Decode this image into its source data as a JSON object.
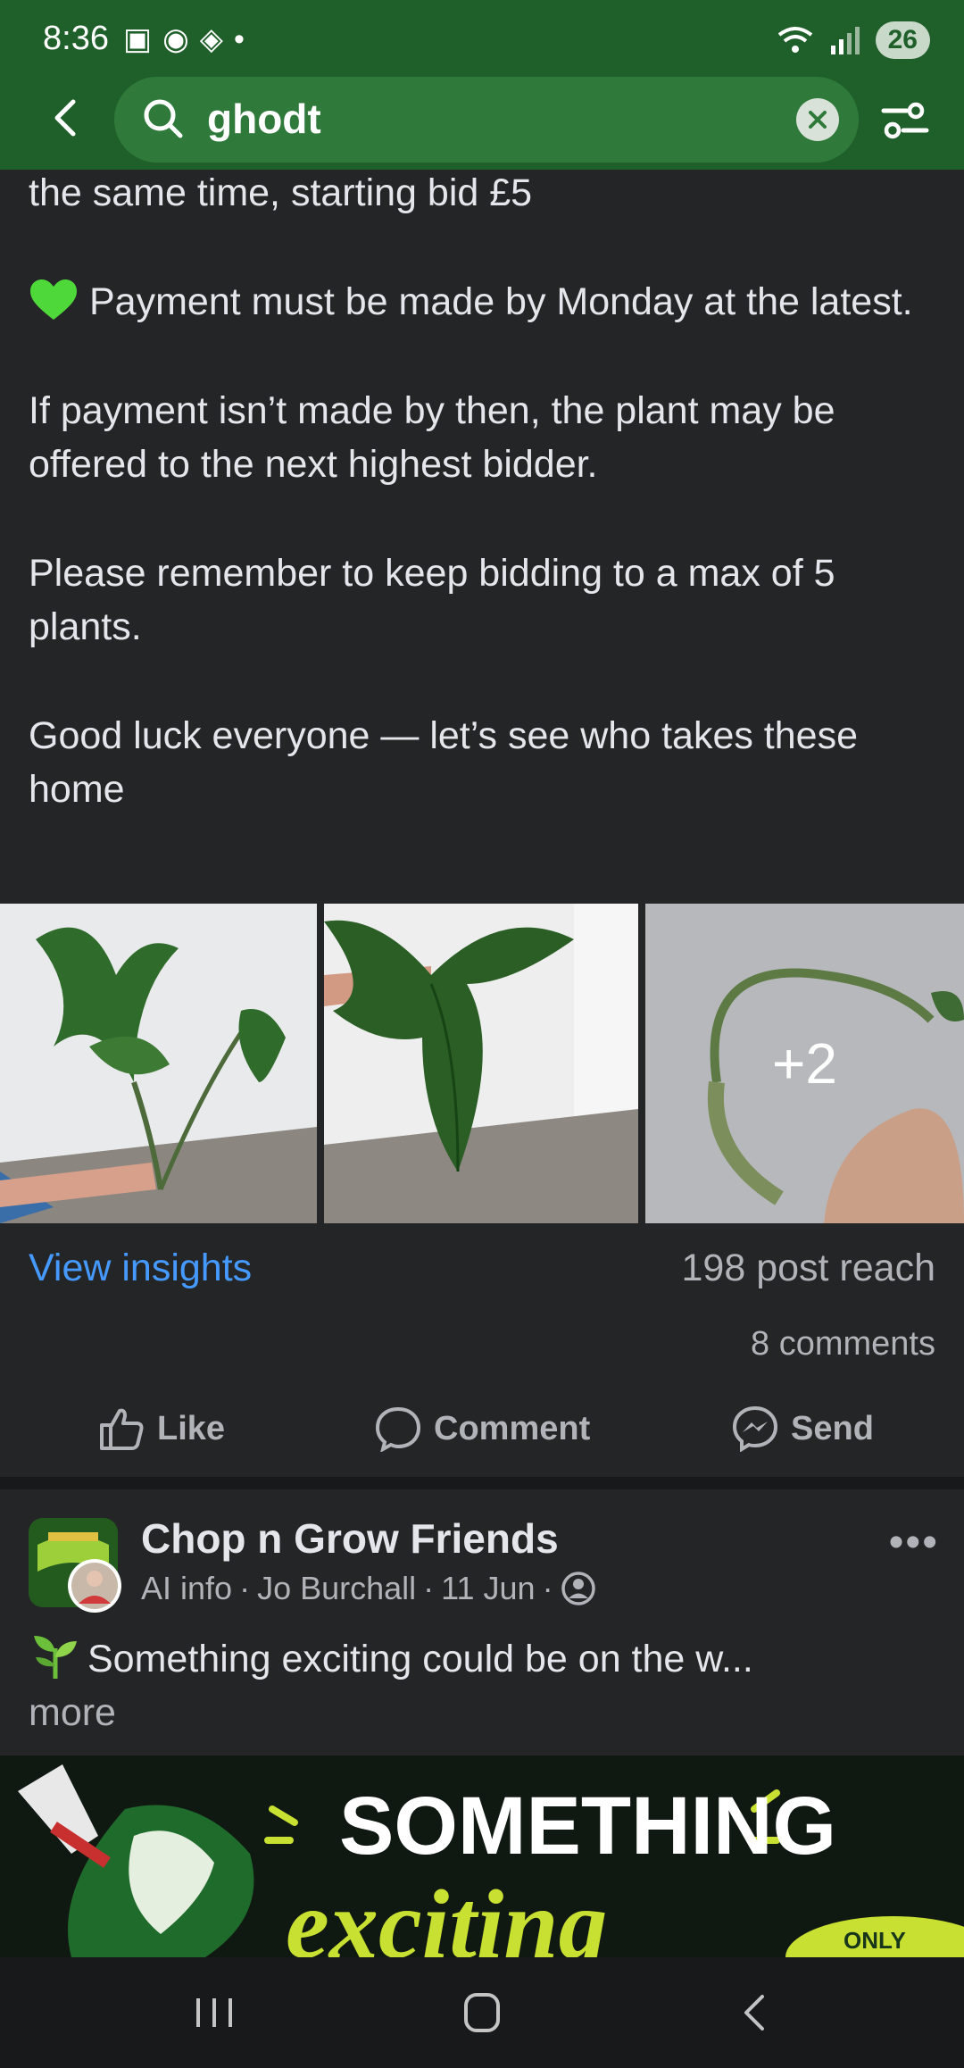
{
  "status": {
    "time": "8:36",
    "battery": "26"
  },
  "search": {
    "query": "ghodt"
  },
  "post": {
    "top_line": "the same time, starting bid £5",
    "payment": "Payment must be made by Monday at the latest.",
    "next_bidder": "If payment isn’t made by then, the plant may be offered to the next highest bidder.",
    "max_plants": "Please remember to keep bidding to a max of 5 plants.",
    "good_luck": "Good luck everyone — let’s see who takes these home",
    "more_photos": "+2",
    "insights_label": "View insights",
    "reach": "198 post reach",
    "comments": "8 comments",
    "actions": {
      "like": "Like",
      "comment": "Comment",
      "send": "Send"
    }
  },
  "second_post": {
    "group": "Chop n Grow Friends",
    "meta_ai": "AI info",
    "author": "Jo Burchall",
    "date": "11 Jun",
    "snippet": "Something exciting could be on the w...",
    "more": "more",
    "banner_line1": "SOMETHING",
    "banner_line2": "exciting",
    "banner_badge": "ONLY"
  },
  "colors": {
    "header_green": "#1f5f2a",
    "link_blue": "#4599ff",
    "background": "#242526"
  }
}
